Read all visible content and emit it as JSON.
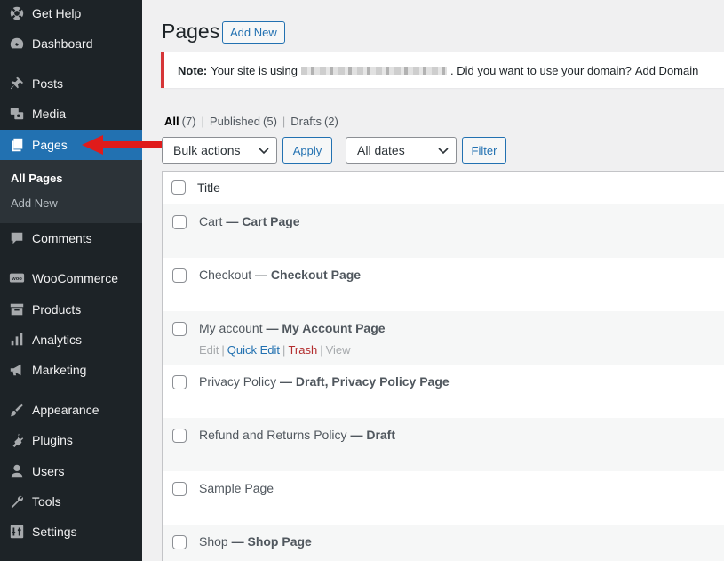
{
  "sidebar": {
    "items": [
      {
        "label": "Get Help",
        "icon": "get-help-icon"
      },
      {
        "label": "Dashboard",
        "icon": "dashboard-icon"
      },
      {
        "label": "Posts",
        "icon": "pushpin-icon"
      },
      {
        "label": "Media",
        "icon": "media-icon"
      },
      {
        "label": "Pages",
        "icon": "pages-icon",
        "active": true
      },
      {
        "label": "Comments",
        "icon": "comments-icon"
      },
      {
        "label": "WooCommerce",
        "icon": "woocommerce-icon"
      },
      {
        "label": "Products",
        "icon": "archive-icon"
      },
      {
        "label": "Analytics",
        "icon": "analytics-icon"
      },
      {
        "label": "Marketing",
        "icon": "megaphone-icon"
      },
      {
        "label": "Appearance",
        "icon": "paintbrush-icon"
      },
      {
        "label": "Plugins",
        "icon": "plugin-icon"
      },
      {
        "label": "Users",
        "icon": "user-icon"
      },
      {
        "label": "Tools",
        "icon": "wrench-icon"
      },
      {
        "label": "Settings",
        "icon": "settings-icon"
      }
    ],
    "submenu": [
      {
        "label": "All Pages",
        "current": true
      },
      {
        "label": "Add New"
      }
    ]
  },
  "header": {
    "title": "Pages",
    "add_new_label": "Add New"
  },
  "notice": {
    "prefix": "Note:",
    "before": "Your site is using",
    "after": ". Did you want to use your domain?",
    "link": "Add Domain"
  },
  "filters": {
    "all": {
      "label": "All",
      "count": "(7)"
    },
    "published": {
      "label": "Published",
      "count": "(5)"
    },
    "drafts": {
      "label": "Drafts",
      "count": "(2)"
    },
    "separator": "|"
  },
  "toolbar": {
    "bulk_actions": "Bulk actions",
    "apply": "Apply",
    "dates": "All dates",
    "filter": "Filter"
  },
  "table": {
    "column_title": "Title",
    "rows": [
      {
        "title": "Cart",
        "state": "— Cart Page"
      },
      {
        "title": "Checkout",
        "state": "— Checkout Page"
      },
      {
        "title": "My account",
        "state": "— My Account Page"
      },
      {
        "title": "Privacy Policy",
        "state": "— Draft, Privacy Policy Page"
      },
      {
        "title": "Refund and Returns Policy",
        "state": "— Draft"
      },
      {
        "title": "Sample Page",
        "state": ""
      },
      {
        "title": "Shop",
        "state": "— Shop Page"
      }
    ],
    "row_actions": {
      "edit": "Edit",
      "quick_edit": "Quick Edit",
      "trash": "Trash",
      "view": "View",
      "separator": "|"
    }
  },
  "colors": {
    "sidebar_bg": "#1d2327",
    "accent": "#2271b1",
    "notice_error": "#d63638",
    "annotation_arrow": "#e01b1b"
  }
}
